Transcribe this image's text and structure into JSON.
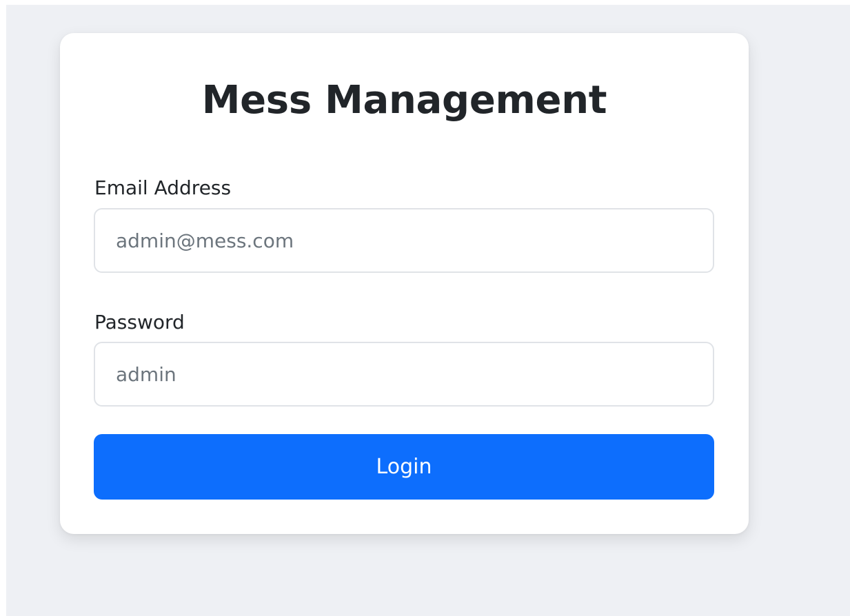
{
  "login": {
    "title": "Mess Management",
    "email": {
      "label": "Email Address",
      "value": "",
      "placeholder": "admin@mess.com"
    },
    "password": {
      "label": "Password",
      "value": "",
      "placeholder": "admin"
    },
    "submit_label": "Login"
  },
  "colors": {
    "background": "#eef0f4",
    "card": "#ffffff",
    "primary": "#0d6efd",
    "text": "#212529",
    "placeholder": "#6c757d",
    "input_border": "#e0e3e7"
  }
}
